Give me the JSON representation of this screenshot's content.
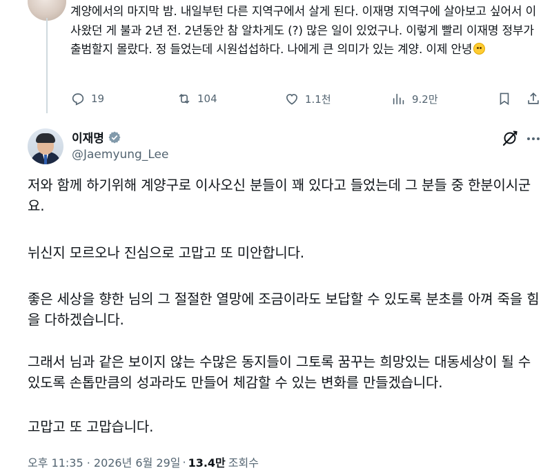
{
  "parent_tweet": {
    "text": "계양에서의 마지막 밤. 내일부턴 다른 지역구에서 살게 된다. 이재명 지역구에 살아보고 싶어서 이사왔던 게 불과 2년 전. 2년동안 참 알차게도 (?) 많은 일이 있었구나. 이렇게 빨리 이재명 정부가 출범할지 몰랐다. 정 들었는데 시원섭섭하다. 나에게 큰 의미가 있는 계양. 이제 안녕",
    "emoji_icon": "face-holding-back-tears-icon",
    "actions": {
      "replies": "19",
      "reposts": "104",
      "likes": "1.1천",
      "views": "9.2만"
    }
  },
  "main_tweet": {
    "display_name": "이재명",
    "handle": "@Jaemyung_Lee",
    "verified": true,
    "paragraphs": [
      "저와 함께 하기위해 계양구로 이사오신 분들이 꽤 있다고 들었는데 그 분들 중 한분이시군요.",
      "뉘신지 모르오나 진심으로 고맙고 또 미안합니다.",
      "좋은 세상을 향한 님의 그 절절한 열망에 조금이라도 보답할 수 있도록 분초를 아껴 죽을 힘을 다하겠습니다.",
      "그래서 님과 같은 보이지 않는 수많은 동지들이 그토록 꿈꾸는 희망있는 대동세상이 될 수 있도록 손톱만큼의 성과라도 만들어 체감할 수 있는 변화를 만들겠습니다.",
      "고맙고 또 고맙습니다."
    ],
    "timestamp": "오후 11:35 · 2026년 6월 29일",
    "separator": "·",
    "views_count": "13.4만",
    "views_label": "조회수"
  },
  "colors": {
    "text_primary": "#0f1419",
    "text_secondary": "#536471",
    "verified_blue": "#1d9bf0",
    "thread_line": "#cfd9de"
  }
}
